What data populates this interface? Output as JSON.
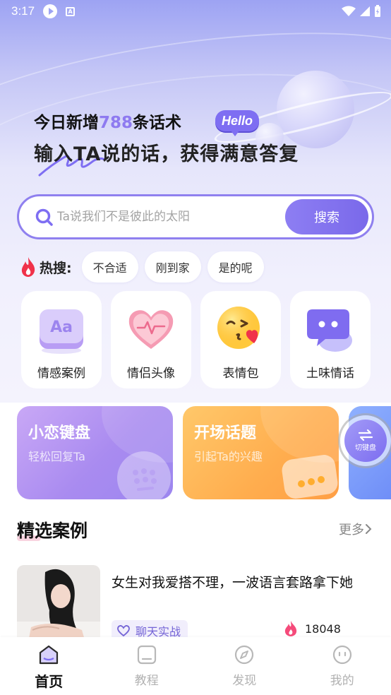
{
  "status_bar": {
    "time": "3:17"
  },
  "hero": {
    "line1_prefix": "今日新增",
    "line1_number": "788",
    "line1_suffix": "条话术",
    "badge": "Hello",
    "line2": "输入TA说的话，获得满意答复"
  },
  "search": {
    "placeholder": "Ta说我们不是彼此的太阳",
    "button_label": "搜索"
  },
  "hot_search": {
    "label": "热搜:",
    "chips": [
      "不合适",
      "刚到家",
      "是的呢"
    ]
  },
  "categories": [
    {
      "label": "情感案例",
      "icon": "aa-text-icon"
    },
    {
      "label": "情侣头像",
      "icon": "heart-pulse-icon"
    },
    {
      "label": "表情包",
      "icon": "kiss-emoji-icon"
    },
    {
      "label": "土味情话",
      "icon": "chat-bubble-icon"
    }
  ],
  "features": [
    {
      "title": "小恋键盘",
      "subtitle": "轻松回复Ta",
      "color": "#a98bf0"
    },
    {
      "title": "开场话题",
      "subtitle": "引起Ta的兴趣",
      "color": "#ffad4e"
    }
  ],
  "switch_keyboard": {
    "label": "切键盘"
  },
  "featured": {
    "title": "精选案例",
    "more": "更多",
    "cases": [
      {
        "title": "女生对我爱搭不理，一波语言套路拿下她",
        "tag": "聊天实战",
        "hot_count": "18048"
      }
    ]
  },
  "bottom_nav": [
    {
      "label": "首页",
      "active": true
    },
    {
      "label": "教程",
      "active": false
    },
    {
      "label": "发现",
      "active": false
    },
    {
      "label": "我的",
      "active": false
    }
  ],
  "colors": {
    "accent": "#8e7af0",
    "hot_red": "#f0324a",
    "orange": "#ffad4e"
  }
}
